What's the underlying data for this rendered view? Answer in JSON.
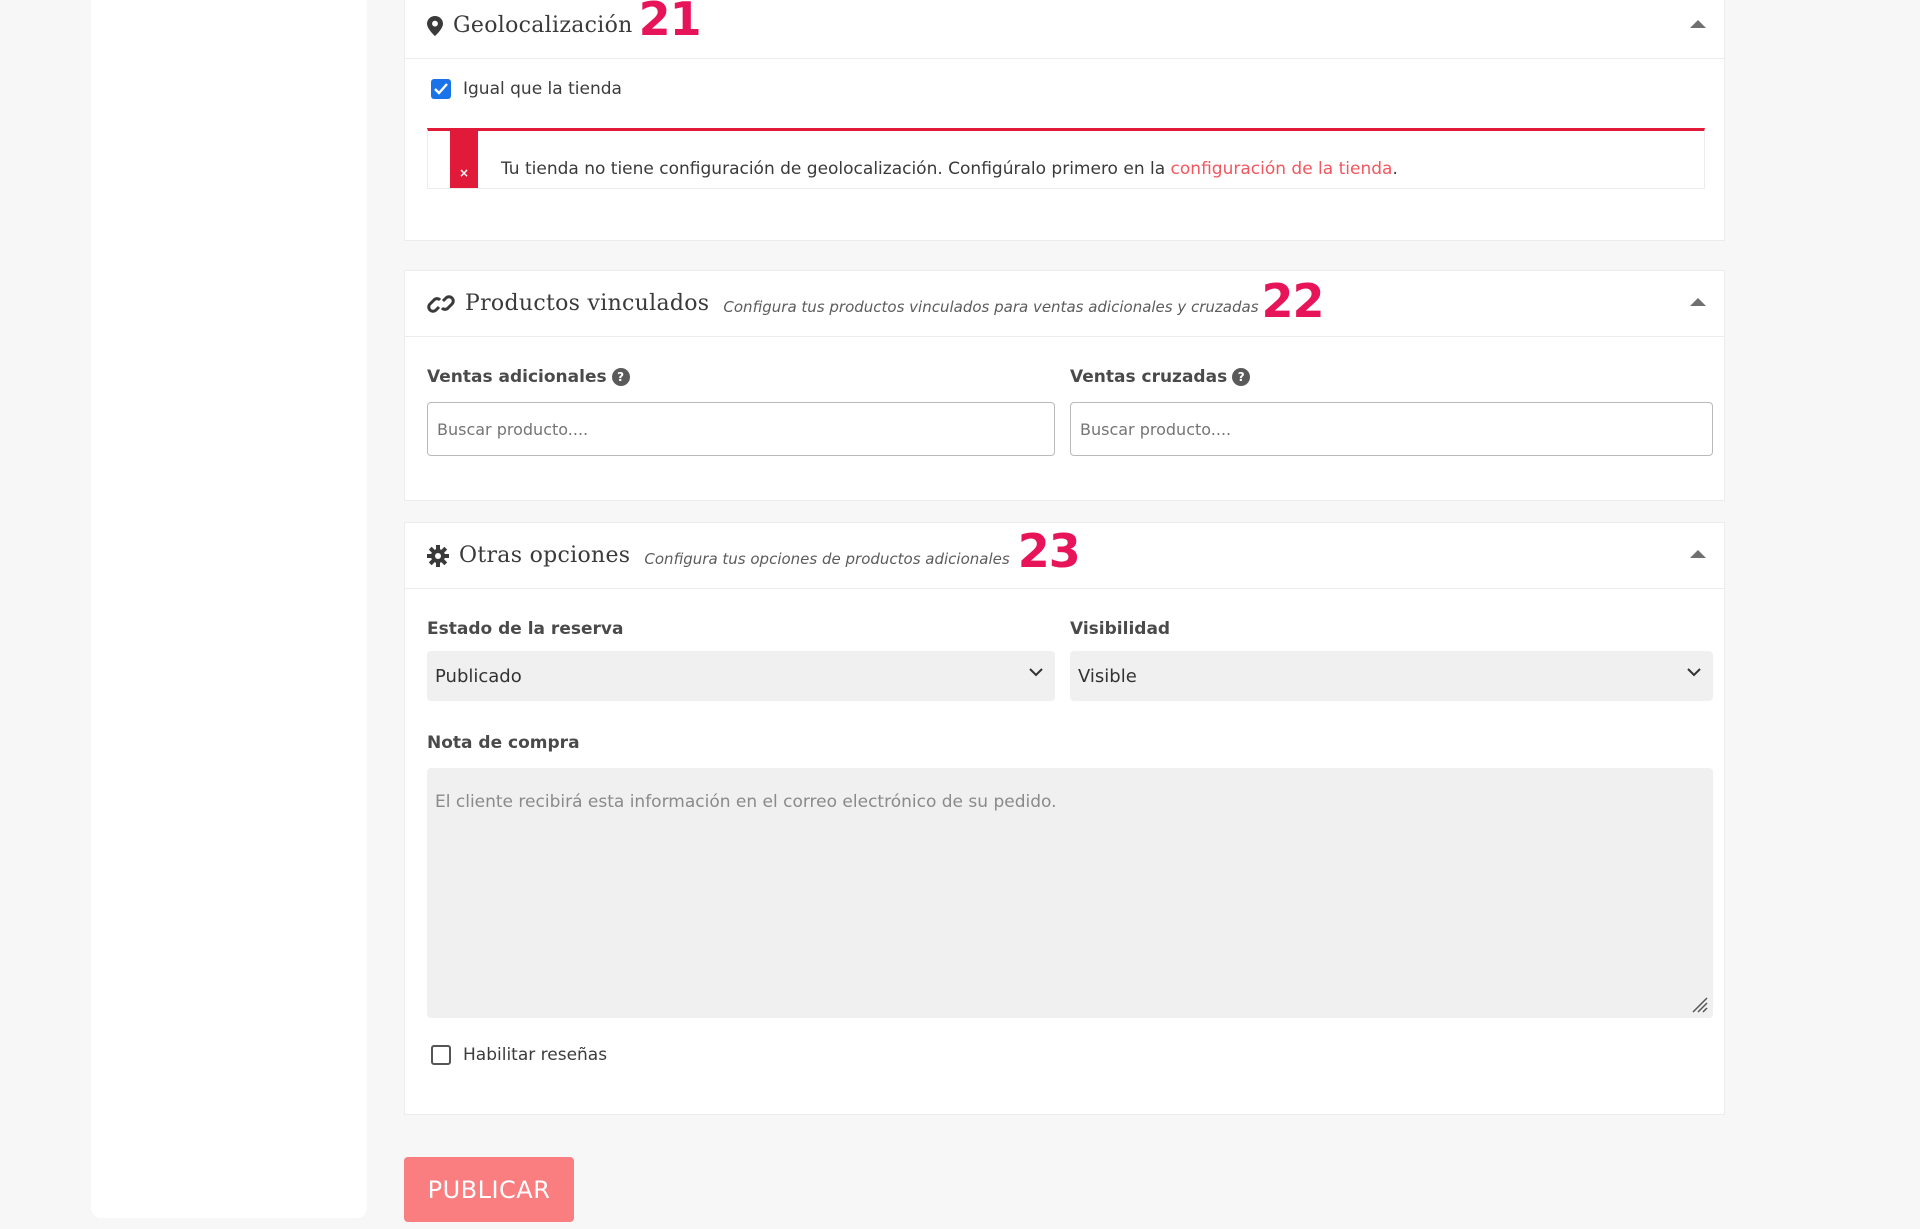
{
  "geolocation": {
    "title": "Geolocalización",
    "step": "21",
    "checkbox_label": "Igual que la tienda",
    "checkbox_checked": true,
    "alert_text": "Tu tienda no tiene configuración de geolocalización. Configúralo primero en la ",
    "alert_link": "configuración de la tienda",
    "alert_suffix": ".",
    "alert_icon": "×"
  },
  "linked_products": {
    "title": "Productos vinculados",
    "subtitle": "Configura tus productos vinculados para ventas adicionales y cruzadas",
    "step": "22",
    "upsells_label": "Ventas adicionales",
    "upsells_placeholder": "Buscar producto....",
    "crosssells_label": "Ventas cruzadas",
    "crosssells_placeholder": "Buscar producto....",
    "help_icon": "?"
  },
  "other_options": {
    "title": "Otras opciones",
    "subtitle": "Configura tus opciones de productos adicionales",
    "step": "23",
    "status_label": "Estado de la reserva",
    "status_value": "Publicado",
    "visibility_label": "Visibilidad",
    "visibility_value": "Visible",
    "note_label": "Nota de compra",
    "note_placeholder": "El cliente recibirá esta información en el correo electrónico de su pedido.",
    "reviews_label": "Habilitar reseñas",
    "reviews_checked": false
  },
  "publish_button": "PUBLICAR",
  "colors": {
    "accent": "#e8145a",
    "error": "#e21a3a",
    "link": "#f2565f",
    "publish": "#fa7d7f",
    "checkbox": "#1a73e8"
  },
  "icons": [
    "map-marker-icon",
    "link-icon",
    "gear-icon",
    "collapse-caret-icon",
    "help-icon",
    "chevron-down-icon",
    "error-x-icon",
    "checkmark-icon",
    "resize-grip-icon"
  ]
}
